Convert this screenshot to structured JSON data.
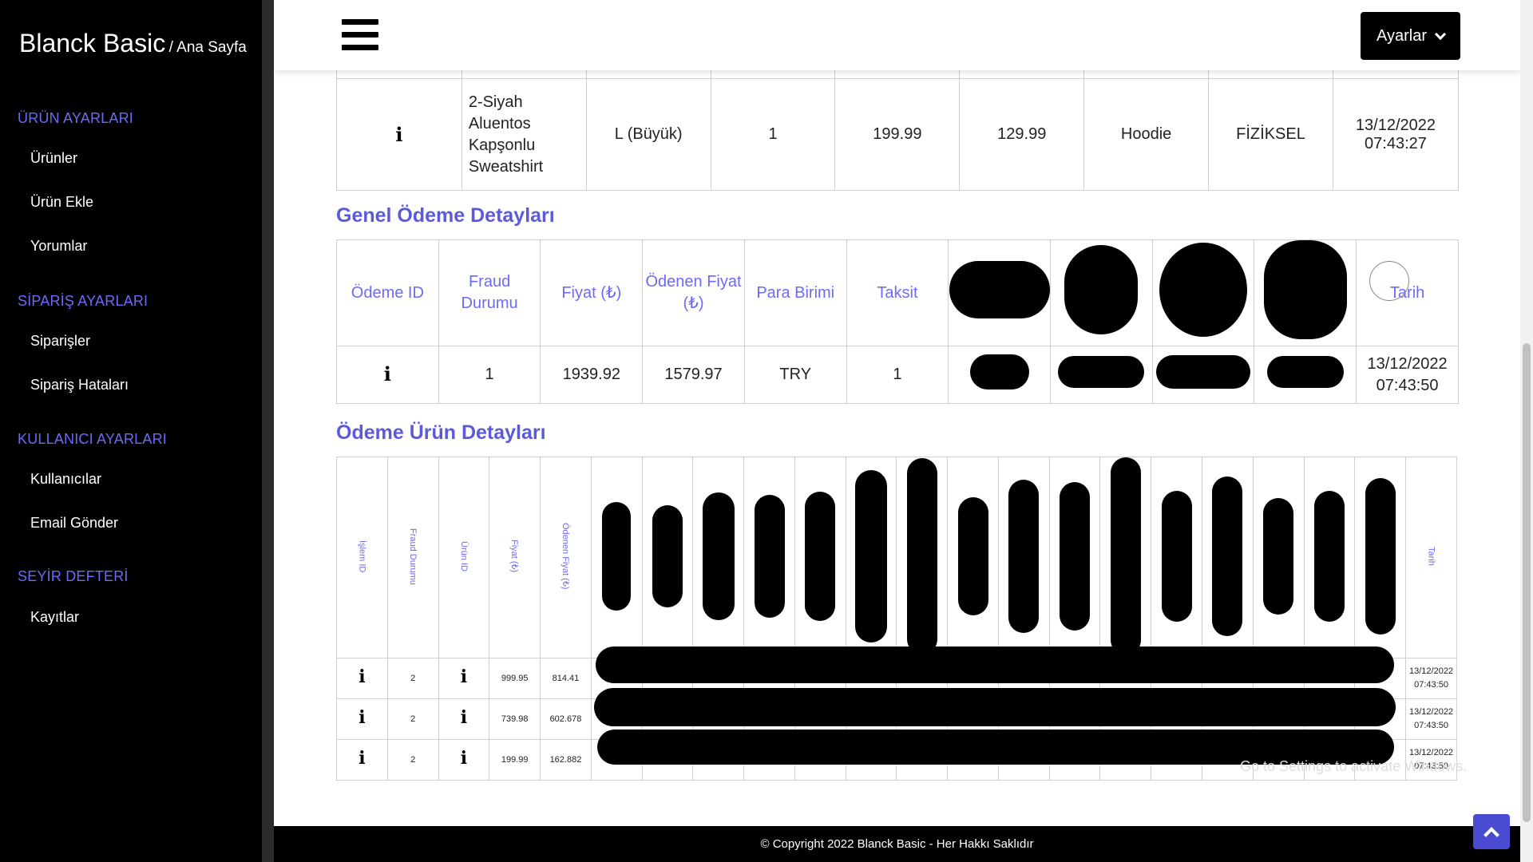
{
  "sidebar": {
    "brand": "Blanck Basic",
    "breadcrumb": "/ Ana Sayfa",
    "sections": [
      {
        "title": "ÜRÜN AYARLARI",
        "items": [
          "Ürünler",
          "Ürün Ekle",
          "Yorumlar"
        ]
      },
      {
        "title": "SİPARİŞ AYARLARI",
        "items": [
          "Siparişler",
          "Sipariş Hataları"
        ]
      },
      {
        "title": "KULLANICI AYARLARI",
        "items": [
          "Kullanıcılar",
          "Email Gönder"
        ]
      },
      {
        "title": "SEYİR DEFTERİ",
        "items": [
          "Kayıtlar"
        ]
      }
    ]
  },
  "header": {
    "settings_label": "Ayarlar"
  },
  "product_row": {
    "info_icon": "i",
    "name": "2-Siyah Aluentos Kapşonlu Sweatshirt",
    "size": "L (Büyük)",
    "quantity": "1",
    "price": "199.99",
    "paid": "129.99",
    "category": "Hoodie",
    "type": "FİZİKSEL",
    "date": "13/12/2022",
    "time": "07:43:27"
  },
  "payment": {
    "title": "Genel Ödeme Detayları",
    "headers": [
      "Ödeme ID",
      "Fraud Durumu",
      "Fiyat (₺)",
      "Ödenen Fiyat (₺)",
      "Para Birimi",
      "Taksit",
      "Tarih"
    ],
    "row": {
      "info_icon": "i",
      "fraud": "1",
      "price": "1939.92",
      "paid": "1579.97",
      "currency": "TRY",
      "installment": "1",
      "date": "13/12/2022",
      "time": "07:43:50"
    }
  },
  "payment_items": {
    "title": "Ödeme Ürün Detayları",
    "headers": [
      "İşlem ID",
      "Fraud Durumu",
      "Ürün ID",
      "Fiyat (₺)",
      "Ödenen Fiyat (₺)",
      "Tarih"
    ],
    "rows": [
      {
        "fraud": "2",
        "price": "999.95",
        "paid": "814.41",
        "date": "13/12/2022",
        "time": "07:43:50"
      },
      {
        "fraud": "2",
        "price": "739.98",
        "paid": "602.678",
        "date": "13/12/2022",
        "time": "07:43:50"
      },
      {
        "fraud": "2",
        "price": "199.99",
        "paid": "162.882",
        "date": "13/12/2022",
        "time": "07:43:50"
      }
    ]
  },
  "watermark": "Go to Settings to activate Windows.",
  "footer": "© Copyright 2022 Blanck Basic - Her Hakkı Saklıdır",
  "icons": {
    "menu": "hamburger-icon",
    "dropdown": "chevron-down-icon",
    "info": "info-icon",
    "scroll_top": "chevron-up-icon"
  },
  "colors": {
    "accent": "#5b5bd9",
    "header_text": "#6b6bf5",
    "sidebar_bg": "#000000",
    "scroll_button": "#4b4bd1"
  }
}
